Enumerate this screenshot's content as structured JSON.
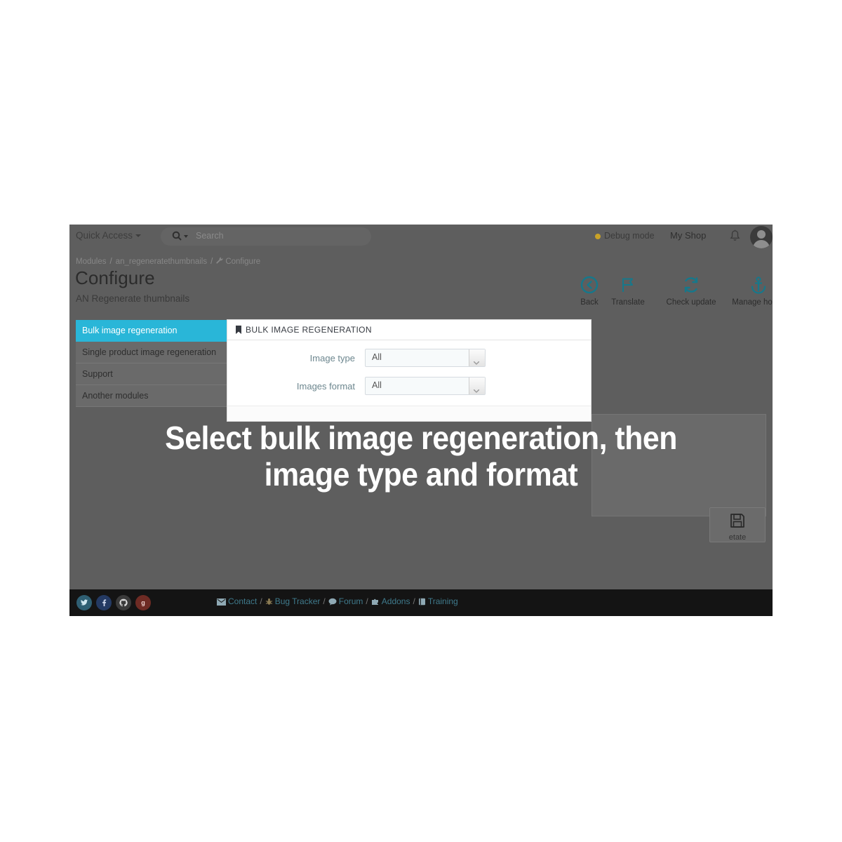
{
  "topbar": {
    "quick_access": "Quick Access",
    "search": {
      "placeholder": "Search",
      "value": ""
    },
    "debug_mode": "Debug mode",
    "shop_name": "My Shop",
    "bell_icon": "bell-icon",
    "avatar_icon": "avatar-icon"
  },
  "breadcrumb": {
    "item1": "Modules",
    "sep1": "/",
    "item2": "an_regeneratethumbnails",
    "sep2": "/",
    "item3": "Configure"
  },
  "header": {
    "title": "Configure",
    "subtitle": "AN Regenerate thumbnails"
  },
  "toolbar": {
    "items": [
      {
        "label": "Back",
        "icon": "back-circle-arrow-icon"
      },
      {
        "label": "Translate",
        "icon": "flag-icon"
      },
      {
        "label": "Check update",
        "icon": "refresh-icon"
      },
      {
        "label": "Manage hooks",
        "icon": "anchor-icon"
      }
    ]
  },
  "sidebar": {
    "items": [
      {
        "label": "Bulk image regeneration",
        "active": true
      },
      {
        "label": "Single product image regeneration",
        "active": false
      },
      {
        "label": "Support",
        "active": false
      },
      {
        "label": "Another modules",
        "active": false
      }
    ]
  },
  "panel": {
    "title": "BULK IMAGE REGENERATION",
    "icon": "bookmark-icon",
    "fields": [
      {
        "label": "Image type",
        "value": "All"
      },
      {
        "label": "Images format",
        "value": "All"
      }
    ]
  },
  "save": {
    "label": "etate",
    "icon": "floppy-save-icon"
  },
  "footer": {
    "social": [
      {
        "name": "twitter-icon",
        "glyph": "t"
      },
      {
        "name": "facebook-icon",
        "glyph": "f"
      },
      {
        "name": "github-icon",
        "glyph": "O"
      },
      {
        "name": "googleplus-icon",
        "glyph": "8"
      }
    ],
    "links": [
      {
        "label": "Contact",
        "icon": "envelope-icon"
      },
      {
        "label": "Bug Tracker",
        "icon": "bug-icon"
      },
      {
        "label": "Forum",
        "icon": "comment-icon"
      },
      {
        "label": "Addons",
        "icon": "puzzle-icon"
      },
      {
        "label": "Training",
        "icon": "book-icon"
      }
    ],
    "separator": "/"
  },
  "caption": {
    "line1": "Select bulk image regeneration, then",
    "line2": "image type and format"
  },
  "colors": {
    "accent": "#29b6d8",
    "toolbar_icon": "#16788b",
    "dim_overlay": "#5e5e5e",
    "footer_bg": "#141414",
    "debug_dot": "#c9a227"
  }
}
